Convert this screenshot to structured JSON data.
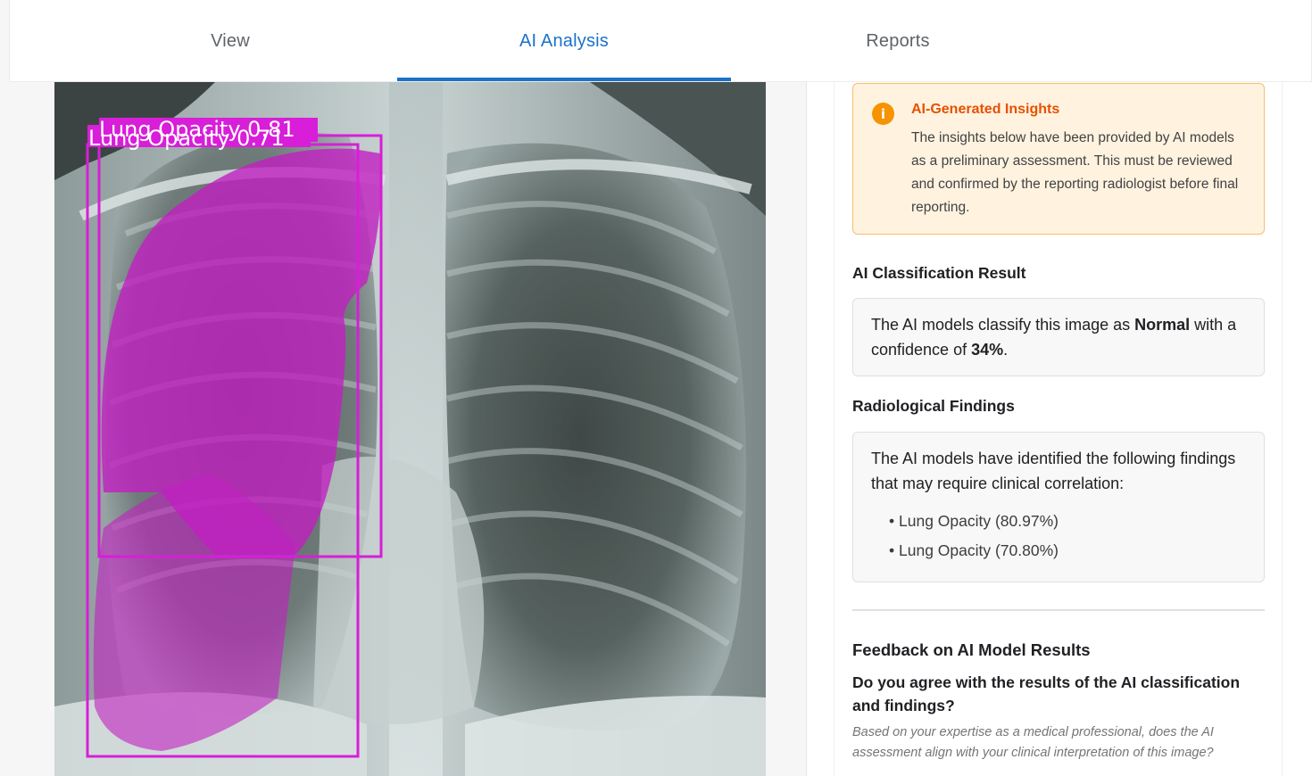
{
  "tabs": [
    {
      "label": "View",
      "active": false
    },
    {
      "label": "AI Analysis",
      "active": true
    },
    {
      "label": "Reports",
      "active": false
    }
  ],
  "image": {
    "detections": [
      {
        "label": "Lung Opacity 0.81",
        "confidence": 0.81
      },
      {
        "label": "Lung Opacity 0.71",
        "confidence": 0.71
      }
    ],
    "overlay_color": "#c21fc2"
  },
  "insights": {
    "icon": "info-icon",
    "title": "AI-Generated Insights",
    "body": "The insights below have been provided by AI models as a preliminary assessment. This must be reviewed and confirmed by the reporting radiologist before final reporting.",
    "accent_color": "#e65100"
  },
  "classification": {
    "heading": "AI Classification Result",
    "text_prefix": "The AI models classify this image as ",
    "label": "Normal",
    "text_middle": " with a confidence of ",
    "confidence": "34%",
    "text_suffix": "."
  },
  "findings": {
    "heading": "Radiological Findings",
    "intro": "The AI models have identified the following findings that may require clinical correlation:",
    "items": [
      "Lung Opacity (80.97%)",
      "Lung Opacity (70.80%)"
    ]
  },
  "feedback": {
    "heading": "Feedback on AI Model Results",
    "question": "Do you agree with the results of the AI classification and findings?",
    "help": "Based on your expertise as a medical professional, does the AI assessment align with your clinical interpretation of this image?"
  }
}
